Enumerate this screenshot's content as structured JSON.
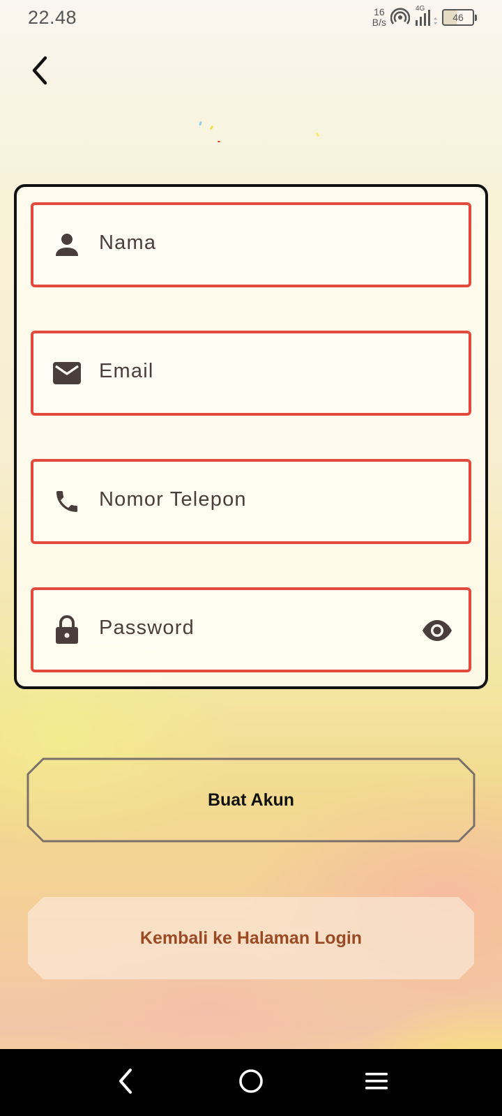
{
  "status_bar": {
    "time": "22.48",
    "net_speed_value": "16",
    "net_speed_unit": "B/s",
    "network_type": "4G",
    "battery_level": "46"
  },
  "header": {
    "back_icon": "chevron-left-icon"
  },
  "form": {
    "fields": [
      {
        "placeholder": "Nama",
        "icon": "person-icon"
      },
      {
        "placeholder": "Email",
        "icon": "mail-icon"
      },
      {
        "placeholder": "Nomor Telepon",
        "icon": "phone-icon"
      },
      {
        "placeholder": "Password",
        "icon": "lock-icon",
        "trailing_icon": "eye-icon"
      }
    ]
  },
  "actions": {
    "create_account_label": "Buat Akun",
    "back_to_login_label": "Kembali ke Halaman Login"
  },
  "colors": {
    "field_border": "#e14a3c",
    "icon": "#4a3e3a",
    "card_border": "#111111",
    "secondary_text": "#9a4a24"
  },
  "nav_bar": {
    "back_icon": "nav-back-icon",
    "home_icon": "nav-home-icon",
    "menu_icon": "nav-menu-icon"
  }
}
